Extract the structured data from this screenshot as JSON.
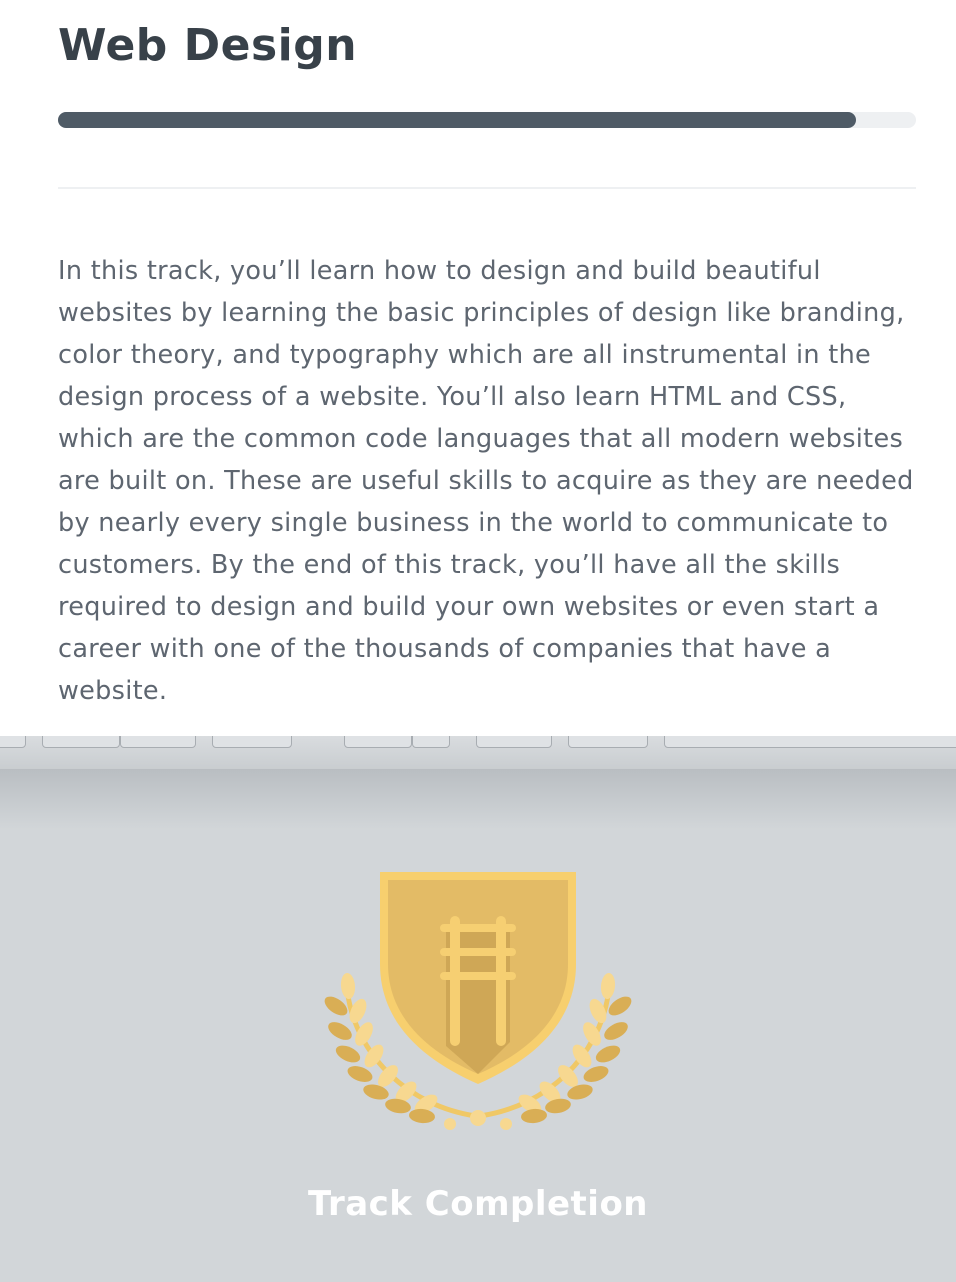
{
  "track": {
    "title": "Web Design",
    "progress": 0.93,
    "description": "In this track, you’ll learn how to design and build beautiful websites by learning the basic principles of design like branding, color theory, and typography which are all instrumental in the design process of a website. You’ll also learn HTML and CSS, which are the common code languages that all modern websites are built on. These are useful skills to acquire as they are needed by nearly every single business in the world to communicate to customers. By the end of this track, you’ll have all the skills required to design and build your own websites or even start a career with one of the thousands of companies that have a website."
  },
  "badge": {
    "icon": "laurel-shield-badge-icon",
    "caption": "Track Completion",
    "colors": {
      "shield": "#e3bb66",
      "shield_border": "#f7cf6e",
      "rails": "#f6cf72",
      "laurel_light": "#f7d890",
      "laurel_dark": "#d9ae55",
      "background": "#d2d6d9"
    }
  }
}
